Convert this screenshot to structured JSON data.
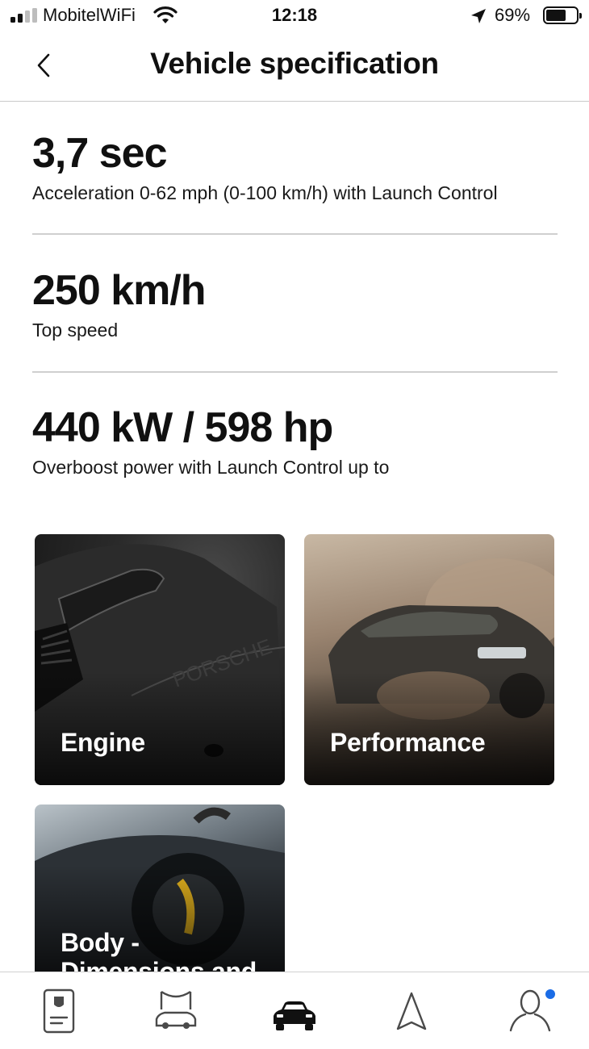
{
  "status_bar": {
    "carrier": "MobitelWiFi",
    "time": "12:18",
    "battery_percent": "69%",
    "battery_level": 0.69,
    "signal_bars_active": 2,
    "signal_bars_total": 4
  },
  "header": {
    "title": "Vehicle specification",
    "back_icon": "chevron-left-icon"
  },
  "specs": [
    {
      "value": "3,7 sec",
      "label": "Acceleration 0-62 mph (0-100 km/h) with Launch Control"
    },
    {
      "value": "250 km/h",
      "label": "Top speed"
    },
    {
      "value": "440 kW / 598 hp",
      "label": "Overboost power with Launch Control up to"
    }
  ],
  "cards": [
    {
      "label": "Engine"
    },
    {
      "label": "Performance"
    },
    {
      "label": "Body -",
      "label_cont": "Dimensions and"
    }
  ],
  "tab_bar": {
    "items": [
      {
        "icon": "vehicle-key-icon"
      },
      {
        "icon": "car-service-icon"
      },
      {
        "icon": "car-icon",
        "active": true
      },
      {
        "icon": "navigation-icon"
      },
      {
        "icon": "profile-icon",
        "badge": true
      }
    ]
  },
  "colors": {
    "text": "#101010",
    "divider": "#cfcfcf",
    "badge": "#1a6ce6",
    "inactive_icon": "#4a4a4a"
  }
}
